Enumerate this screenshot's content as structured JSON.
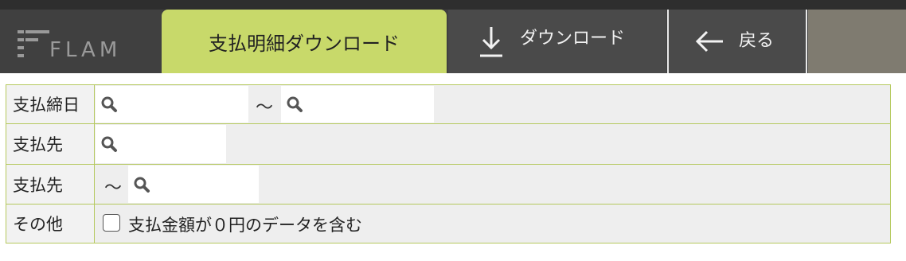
{
  "header": {
    "logo_text": "FLAM",
    "active_tab_label": "支払明細ダウンロード",
    "download_label": "ダウンロード",
    "back_label": "戻る"
  },
  "form": {
    "rows": [
      {
        "label": "支払締日",
        "range_separator": "～"
      },
      {
        "label": "支払先"
      },
      {
        "label": "支払先",
        "range_separator": "～"
      },
      {
        "label": "その他",
        "checkbox_label": "支払金額が０円のデータを含む",
        "checkbox_checked": false
      }
    ]
  },
  "icons": {
    "search": "search-icon",
    "download": "download-arrow-icon",
    "back": "arrow-left-icon"
  },
  "colors": {
    "accent": "#c8d96a",
    "header_bg": "#404040",
    "border": "#b5c95e"
  }
}
